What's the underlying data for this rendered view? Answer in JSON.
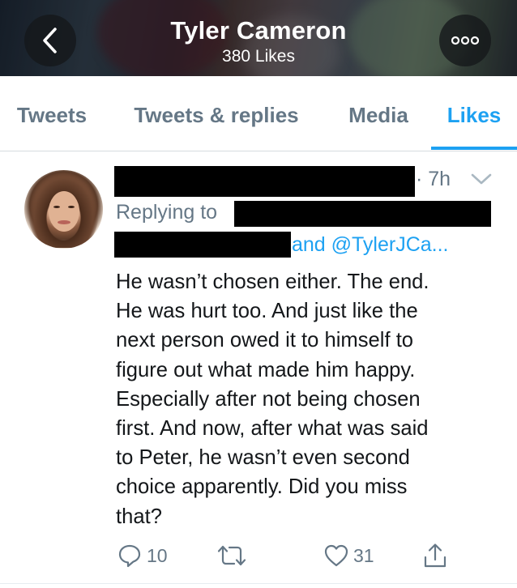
{
  "header": {
    "title": "Tyler Cameron",
    "subtitle": "380 Likes",
    "back_icon": "chevron-left-icon",
    "more_icon": "more-horizontal-icon"
  },
  "tabs": [
    {
      "label": "Tweets",
      "active": false
    },
    {
      "label": "Tweets & replies",
      "active": false
    },
    {
      "label": "Media",
      "active": false
    },
    {
      "label": "Likes",
      "active": true
    }
  ],
  "tweet": {
    "time": "· 7h",
    "reply_prefix": "Replying to",
    "reply_suffix": "and @TylerJCa...",
    "text_lines": [
      "He wasn’t chosen either. The end.",
      "He was hurt too. And just like the",
      "next person owed it to himself to",
      "figure out what made him happy.",
      "Especially after not being chosen",
      "first. And now, after what was said",
      "to Peter, he wasn’t even second",
      "choice apparently. Did you miss",
      "that?"
    ],
    "actions": {
      "reply_count": "10",
      "retweet_count": "",
      "like_count": "31"
    }
  },
  "colors": {
    "accent": "#1da1f2",
    "secondary_text": "#657786",
    "primary_text": "#14171a"
  }
}
